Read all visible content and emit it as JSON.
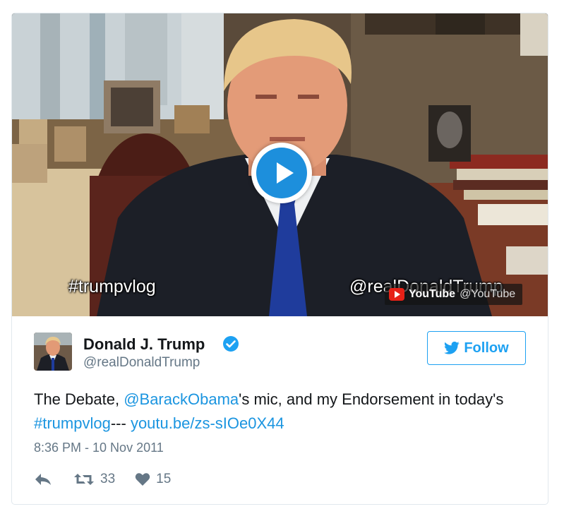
{
  "video": {
    "hashtag_overlay": "#trumpvlog",
    "handle_overlay": "@realDonaldTrump",
    "youtube_badge": {
      "brand": "YouTube",
      "handle": "@YouTube"
    }
  },
  "author": {
    "display_name": "Donald J. Trump",
    "screen_name": "@realDonaldTrump",
    "verified": true
  },
  "follow_button": {
    "label": "Follow",
    "icon": "twitter-bird-icon"
  },
  "tweet": {
    "segments": {
      "t1": "The Debate, ",
      "mention": "@BarackObama",
      "t2": "'s mic, and my Endorsement in today's ",
      "hashtag": "#trumpvlog",
      "t3": "--- ",
      "link": "youtu.be/zs-sIOe0X44"
    },
    "timestamp": "8:36 PM - 10 Nov 2011"
  },
  "actions": {
    "reply_icon": "reply-icon",
    "retweet_icon": "retweet-icon",
    "retweet_count": "33",
    "like_icon": "heart-icon",
    "like_count": "15"
  },
  "colors": {
    "link": "#1b95e0",
    "brand": "#1da1f2",
    "muted": "#657786",
    "play_button": "#1d8fdc",
    "youtube_red": "#e62117"
  }
}
